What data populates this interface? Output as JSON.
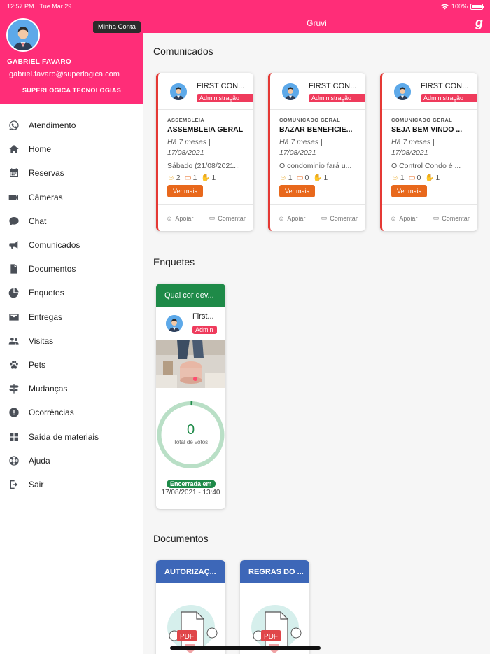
{
  "status_bar": {
    "time": "12:57 PM",
    "date": "Tue Mar 29",
    "battery": "100%"
  },
  "header": {
    "title": "Gruvi",
    "logo": "g"
  },
  "profile": {
    "account_button": "Minha Conta",
    "name": "GABRIEL FAVARO",
    "email": "gabriel.favaro@superlogica.com",
    "company": "SUPERLOGICA TECNOLOGIAS"
  },
  "menu": [
    {
      "label": "Atendimento",
      "icon": "whatsapp-icon"
    },
    {
      "label": "Home",
      "icon": "home-icon"
    },
    {
      "label": "Reservas",
      "icon": "calendar-icon"
    },
    {
      "label": "Câmeras",
      "icon": "video-camera-icon"
    },
    {
      "label": "Chat",
      "icon": "chat-bubble-icon"
    },
    {
      "label": "Comunicados",
      "icon": "megaphone-icon"
    },
    {
      "label": "Documentos",
      "icon": "document-icon"
    },
    {
      "label": "Enquetes",
      "icon": "pie-chart-icon"
    },
    {
      "label": "Entregas",
      "icon": "envelope-icon"
    },
    {
      "label": "Visitas",
      "icon": "people-icon"
    },
    {
      "label": "Pets",
      "icon": "paw-icon"
    },
    {
      "label": "Mudanças",
      "icon": "signpost-icon"
    },
    {
      "label": "Ocorrências",
      "icon": "alert-icon"
    },
    {
      "label": "Saída de materiais",
      "icon": "grid-icon"
    },
    {
      "label": "Ajuda",
      "icon": "lifebuoy-icon"
    },
    {
      "label": "Sair",
      "icon": "logout-icon"
    }
  ],
  "sections": {
    "comunicados": "Comunicados",
    "enquetes": "Enquetes",
    "documentos": "Documentos"
  },
  "comunicados": [
    {
      "author": "FIRST CON...",
      "role": "Administração",
      "category": "ASSEMBLEIA",
      "title": "ASSEMBLEIA GERAL",
      "date": "Há 7 meses | 17/08/2021",
      "excerpt": "Sábado (21/08/2021...",
      "likes": "2",
      "comments": "1",
      "claps": "1",
      "more": "Ver mais",
      "support": "Apoiar",
      "comment": "Comentar"
    },
    {
      "author": "FIRST CON...",
      "role": "Administração",
      "category": "COMUNICADO GERAL",
      "title": "BAZAR BENEFICIE...",
      "date": "Há 7 meses | 17/08/2021",
      "excerpt": "O condominio fará u...",
      "likes": "1",
      "comments": "0",
      "claps": "1",
      "more": "Ver mais",
      "support": "Apoiar",
      "comment": "Comentar"
    },
    {
      "author": "FIRST CON...",
      "role": "Administração",
      "category": "COMUNICADO GERAL",
      "title": "SEJA BEM VINDO ...",
      "date": "Há 7 meses | 17/08/2021",
      "excerpt": "O Control Condo é ...",
      "likes": "1",
      "comments": "0",
      "claps": "1",
      "more": "Ver mais",
      "support": "Apoiar",
      "comment": "Comentar"
    }
  ],
  "enquete": {
    "title": "Qual cor dev...",
    "author": "First...",
    "role": "Admin",
    "votes": "0",
    "votes_label": "Total de votos",
    "status": "Encerrada em",
    "closed_date": "17/08/2021 - 13:40"
  },
  "documentos": [
    {
      "title": "AUTORIZAÇ...",
      "badge": "PDF"
    },
    {
      "title": "REGRAS DO ...",
      "badge": "PDF"
    }
  ],
  "colors": {
    "brand": "#ff2d78",
    "poll": "#1e8a48",
    "docs": "#3d67b8",
    "more_button": "#e8681c",
    "role_badge": "#ef3b5c"
  }
}
